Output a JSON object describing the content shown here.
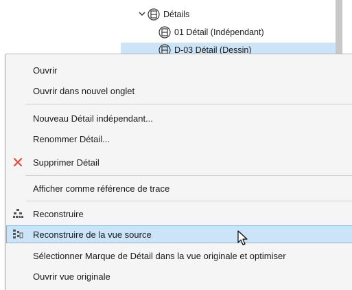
{
  "tree": {
    "folder_label": "Détails",
    "item1_label": "01 Détail (Indépendant)",
    "item2_label": "D-03 Détail (Dessin)"
  },
  "menu": {
    "items": [
      {
        "label": "Ouvrir"
      },
      {
        "label": "Ouvrir dans nouvel onglet"
      },
      {
        "label": "Nouveau Détail indépendant..."
      },
      {
        "label": "Renommer Détail..."
      },
      {
        "label": "Supprimer Détail"
      },
      {
        "label": "Afficher comme référence de trace"
      },
      {
        "label": "Reconstruire"
      },
      {
        "label": "Reconstruire de la vue source"
      },
      {
        "label": "Sélectionner Marque de Détail dans la vue originale et optimiser"
      },
      {
        "label": "Ouvrir vue originale"
      }
    ]
  },
  "colors": {
    "highlight": "#cce4f7",
    "highlight_border": "#7ab4e3",
    "delete_icon": "#e8432f"
  },
  "icons": {
    "tree_chevron": "chevron-down-icon",
    "tree_node": "detail-node-icon",
    "delete": "close-icon",
    "rebuild": "rebuild-icon",
    "rebuild_source": "rebuild-source-icon",
    "cursor": "mouse-pointer-icon"
  }
}
